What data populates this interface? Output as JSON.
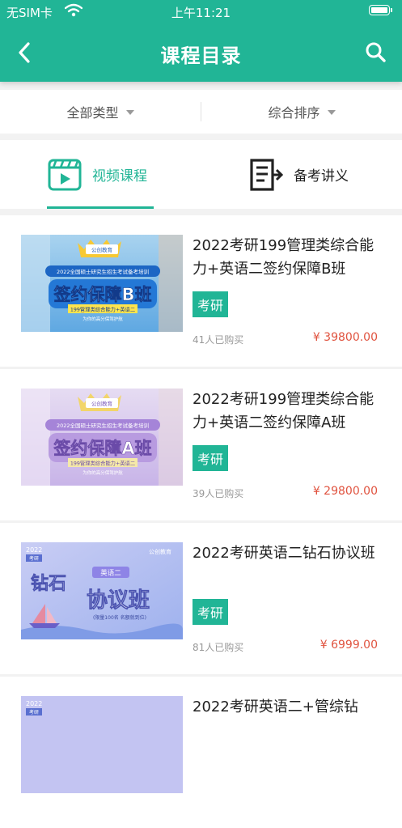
{
  "status_bar": {
    "carrier": "无SIM卡",
    "time": "上午11:21"
  },
  "nav": {
    "title": "课程目录",
    "back_icon": "chevron-left-icon",
    "search_icon": "search-icon"
  },
  "filters": [
    {
      "label": "全部类型"
    },
    {
      "label": "综合排序"
    }
  ],
  "tabs": [
    {
      "label": "视频课程",
      "icon": "video-course-icon",
      "active": true
    },
    {
      "label": "备考讲义",
      "icon": "handout-icon",
      "active": false
    }
  ],
  "courses": [
    {
      "title": "2022考研199管理类综合能力+英语二签约保障B班",
      "tag": "考研",
      "buyers": "41人已购买",
      "price": "¥ 39800.00",
      "thumb": {
        "logo": "公创教育",
        "banner": "2022全国硕士研究生招生考试备考培训",
        "headline": "签约保障B班",
        "subline": "199管理类综合能力+英语二",
        "footer": "为你的高分保驾护航"
      }
    },
    {
      "title": "2022考研199管理类综合能力+英语二签约保障A班",
      "tag": "考研",
      "buyers": "39人已购买",
      "price": "¥ 29800.00",
      "thumb": {
        "logo": "公创教育",
        "banner": "2022全国硕士研究生招生考试备考培训",
        "headline": "签约保障A班",
        "subline": "199管理类综合能力+英语二",
        "footer": "为你的高分保驾护航"
      }
    },
    {
      "title": "2022考研英语二钻石协议班",
      "tag": "考研",
      "buyers": "81人已购买",
      "price": "¥ 6999.00",
      "thumb": {
        "logo": "公创教育",
        "year": "2022",
        "year_sub": "考研",
        "subject": "英语二",
        "headline_a": "钻石",
        "headline_b": "协议班",
        "footer": "(限量100名 名额就到位)"
      }
    },
    {
      "title": "2022考研英语二+管综钻",
      "tag": "",
      "buyers": "",
      "price": "",
      "thumb": {
        "year": "2022",
        "year_sub": "考研"
      }
    }
  ],
  "colors": {
    "brand": "#21b596",
    "price": "#e0533f"
  }
}
